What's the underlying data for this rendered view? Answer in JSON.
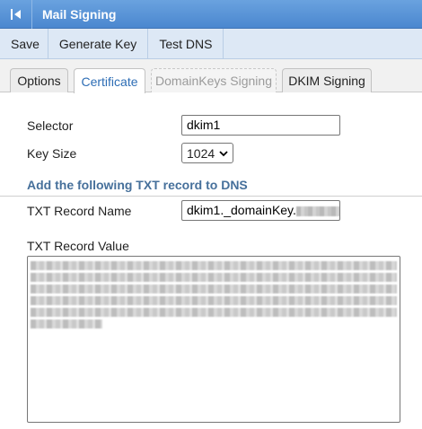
{
  "window": {
    "title": "Mail Signing",
    "back_icon": "collapse-left-icon"
  },
  "toolbar": {
    "save_label": "Save",
    "generate_key_label": "Generate Key",
    "test_dns_label": "Test DNS"
  },
  "tabs": [
    {
      "label": "Options",
      "state": "normal"
    },
    {
      "label": "Certificate",
      "state": "active"
    },
    {
      "label": "DomainKeys Signing",
      "state": "disabled"
    },
    {
      "label": "DKIM Signing",
      "state": "normal"
    }
  ],
  "form": {
    "selector_label": "Selector",
    "selector_value": "dkim1",
    "key_size_label": "Key Size",
    "key_size_value": "1024",
    "section_heading": "Add the following TXT record to DNS",
    "txt_record_name_label": "TXT Record Name",
    "txt_record_name_value": "dkim1._domainKey.",
    "txt_record_value_label": "TXT Record Value"
  },
  "colors": {
    "accent": "#2d6db5",
    "titlebar": "#5a95d8",
    "heading": "#46709b"
  }
}
